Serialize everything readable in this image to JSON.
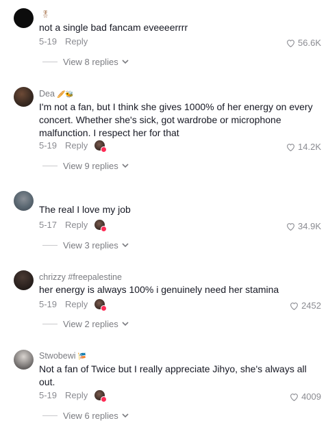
{
  "comments": [
    {
      "username": "",
      "badge": "🎖",
      "text": "not a single bad fancam eveeeerrrr",
      "date": "5-19",
      "reply_label": "Reply",
      "likes": "56.6K",
      "creator_liked": false,
      "view_replies": "View 8 replies"
    },
    {
      "username": "Dea",
      "badge": "🥖🐝",
      "text": "I'm not a fan, but I think she gives 1000% of her energy on every concert. Whether she's sick, got wardrobe or microphone malfunction. I respect her for that",
      "date": "5-19",
      "reply_label": "Reply",
      "likes": "14.2K",
      "creator_liked": true,
      "view_replies": "View 9 replies"
    },
    {
      "username": "",
      "badge": "",
      "text": "The real I love my job",
      "date": "5-17",
      "reply_label": "Reply",
      "likes": "34.9K",
      "creator_liked": true,
      "view_replies": "View 3 replies"
    },
    {
      "username": "chrizzy #freepalestine",
      "badge": "",
      "text": "her energy is always 100% i genuinely need her stamina",
      "date": "5-19",
      "reply_label": "Reply",
      "likes": "2452",
      "creator_liked": true,
      "view_replies": "View 2 replies"
    },
    {
      "username": "Stwobewi",
      "badge": "🎏",
      "text": "Not a fan of Twice but I really appreciate Jihyo, she's always all out.",
      "date": "5-19",
      "reply_label": "Reply",
      "likes": "4009",
      "creator_liked": true,
      "view_replies": "View 6 replies"
    }
  ],
  "colors": {
    "text": "#161823",
    "muted": "#8a8b91",
    "like_badge": "#fe2c55"
  },
  "icons": {
    "like": "heart-outline-icon",
    "expand": "chevron-down-icon",
    "creator_liked": "creator-liked-avatar-icon"
  }
}
